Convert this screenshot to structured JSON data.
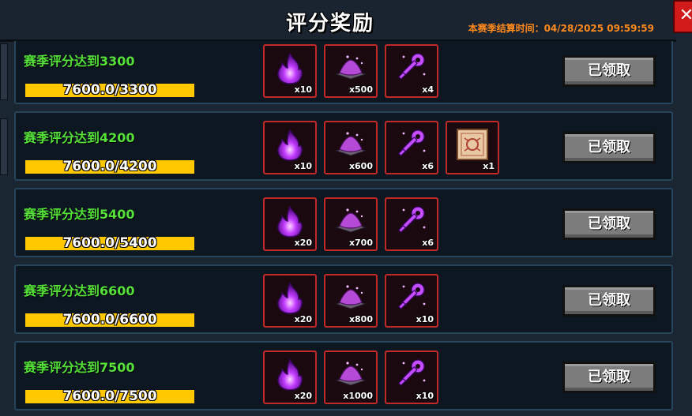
{
  "header": {
    "title": "评分奖励",
    "season_end": "本赛季结算时间：04/28/2025 09:59:59",
    "close_glyph": "✕"
  },
  "rows": [
    {
      "label": "赛季评分达到3300",
      "progress_text": "7600.0/3300",
      "progress_fraction": 1.0,
      "rewards": [
        {
          "icon": "flame-icon",
          "qty": "x10"
        },
        {
          "icon": "powder-pile-icon",
          "qty": "x500"
        },
        {
          "icon": "key-icon",
          "qty": "x4"
        }
      ],
      "button": "已领取"
    },
    {
      "label": "赛季评分达到4200",
      "progress_text": "7600.0/4200",
      "progress_fraction": 1.0,
      "rewards": [
        {
          "icon": "flame-icon",
          "qty": "x10"
        },
        {
          "icon": "powder-pile-icon",
          "qty": "x600"
        },
        {
          "icon": "key-icon",
          "qty": "x6"
        },
        {
          "icon": "scroll-icon",
          "qty": "x1"
        }
      ],
      "button": "已领取"
    },
    {
      "label": "赛季评分达到5400",
      "progress_text": "7600.0/5400",
      "progress_fraction": 1.0,
      "rewards": [
        {
          "icon": "flame-icon",
          "qty": "x20"
        },
        {
          "icon": "powder-pile-icon",
          "qty": "x700"
        },
        {
          "icon": "key-icon",
          "qty": "x6"
        }
      ],
      "button": "已领取"
    },
    {
      "label": "赛季评分达到6600",
      "progress_text": "7600.0/6600",
      "progress_fraction": 1.0,
      "rewards": [
        {
          "icon": "flame-icon",
          "qty": "x20"
        },
        {
          "icon": "powder-pile-icon",
          "qty": "x800"
        },
        {
          "icon": "key-icon",
          "qty": "x10"
        }
      ],
      "button": "已领取"
    },
    {
      "label": "赛季评分达到7500",
      "progress_text": "7600.0/7500",
      "progress_fraction": 1.0,
      "rewards": [
        {
          "icon": "flame-icon",
          "qty": "x20"
        },
        {
          "icon": "powder-pile-icon",
          "qty": "x1000"
        },
        {
          "icon": "key-icon",
          "qty": "x10"
        }
      ],
      "button": "已领取"
    }
  ],
  "colors": {
    "label_green": "#55e03a",
    "progress_yellow": "#ffc800",
    "slot_border_red": "#c22a2a",
    "countdown_orange": "#ff8a1c"
  }
}
